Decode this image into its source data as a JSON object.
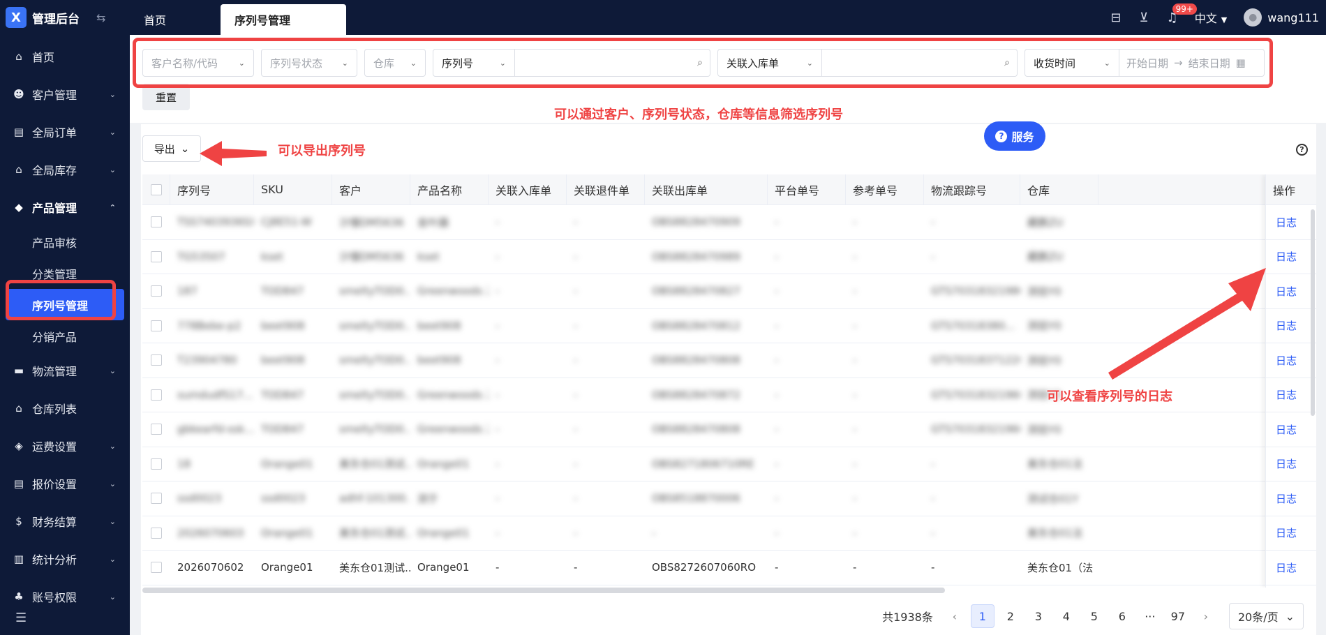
{
  "app": {
    "title": "管理后台",
    "logo_letter": "X"
  },
  "sidebar": {
    "items": [
      {
        "label": "首页",
        "icon": "home-icon",
        "glyph": "⌂",
        "arrow": ""
      },
      {
        "label": "客户管理",
        "icon": "users-icon",
        "glyph": "☻",
        "arrow": "⌄"
      },
      {
        "label": "全局订单",
        "icon": "clipboard-icon",
        "glyph": "▤",
        "arrow": "⌄"
      },
      {
        "label": "全局库存",
        "icon": "warehouse-icon",
        "glyph": "⌂",
        "arrow": "⌄"
      },
      {
        "label": "产品管理",
        "icon": "box-icon",
        "glyph": "◆",
        "arrow": "⌃"
      }
    ],
    "sub_items": [
      {
        "label": "产品审核"
      },
      {
        "label": "分类管理"
      },
      {
        "label": "序列号管理"
      },
      {
        "label": "分销产品"
      }
    ],
    "items_after": [
      {
        "label": "物流管理",
        "icon": "truck-icon",
        "glyph": "▬",
        "arrow": "⌄"
      },
      {
        "label": "仓库列表",
        "icon": "warehouse-list-icon",
        "glyph": "⌂",
        "arrow": ""
      },
      {
        "label": "运费设置",
        "icon": "shipping-fee-icon",
        "glyph": "◈",
        "arrow": "⌄"
      },
      {
        "label": "报价设置",
        "icon": "quote-icon",
        "glyph": "▤",
        "arrow": "⌄"
      },
      {
        "label": "财务结算",
        "icon": "finance-icon",
        "glyph": "$",
        "arrow": "⌄"
      },
      {
        "label": "统计分析",
        "icon": "chart-icon",
        "glyph": "▥",
        "arrow": "⌄"
      },
      {
        "label": "账号权限",
        "icon": "org-icon",
        "glyph": "♣",
        "arrow": "⌄"
      }
    ]
  },
  "topbar": {
    "tabs": [
      {
        "label": "首页"
      },
      {
        "label": "序列号管理"
      }
    ],
    "notification_badge": "99+",
    "language": "中文",
    "username": "wang111"
  },
  "filters": {
    "customer_placeholder": "客户名称/代码",
    "status_placeholder": "序列号状态",
    "warehouse_placeholder": "仓库",
    "serial_type": "序列号",
    "inbound_type": "关联入库单",
    "time_type": "收货时间",
    "start_date": "开始日期",
    "end_date": "结束日期",
    "reset_label": "重置"
  },
  "annotations": {
    "filter_note": "可以通过客户、序列号状态，仓库等信息筛选序列号",
    "export_note": "可以导出序列号",
    "log_note": "可以查看序列号的日志"
  },
  "toolbar": {
    "export_label": "导出",
    "service_label": "服务"
  },
  "table": {
    "columns": [
      "序列号",
      "SKU",
      "客户",
      "产品名称",
      "关联入库单",
      "关联退件单",
      "关联出库单",
      "平台单号",
      "参考单号",
      "物流跟踪号",
      "仓库"
    ],
    "op_header": "操作",
    "op_label": "日志",
    "rows": [
      [
        "TSS7403936SX",
        "CJ8E51-W",
        "沙慢DM5636",
        "金叶器",
        "-",
        "-",
        "OBS8828470909",
        "-",
        "-",
        "-",
        "藏鹏ZU"
      ],
      [
        "TG53507",
        "kset",
        "沙慢DM5636",
        "kset",
        "-",
        "-",
        "OBS8828470989",
        "-",
        "-",
        "-",
        "藏鹏ZU"
      ],
      [
        "187",
        "TOD847",
        "smeltyTOD0...",
        "Greenwoods 26...",
        "-",
        "-",
        "OBS8828470827",
        "-",
        "-",
        "GTS70318321980...",
        "测验Y0"
      ],
      [
        "778Bebe-p2",
        "beet908",
        "smeltyTOD0...",
        "beet908",
        "-",
        "-",
        "OBS8828470812",
        "-",
        "-",
        "GTS70318380...",
        "测验Y0"
      ],
      [
        "T23904780",
        "beet908",
        "smeltyTOD0...",
        "beet908",
        "-",
        "-",
        "OBS8828470808",
        "-",
        "-",
        "GTS70318371220...",
        "测验Y0"
      ],
      [
        "sumdudfS17...",
        "TOD847",
        "smeltyTOD0...",
        "Greenwoods 26...",
        "-",
        "-",
        "OBS8828470872",
        "-",
        "-",
        "GTS70318321960...",
        "测验Y0"
      ],
      [
        "gbkearfd-ssk...",
        "TOD847",
        "smeltyTOD0...",
        "Greenwoods 26...",
        "-",
        "-",
        "OBS8828470808",
        "-",
        "-",
        "GTS70318321960...",
        "测验Y0"
      ],
      [
        "18",
        "Orange01",
        "美东仓01测试...",
        "Orange01",
        "-",
        "-",
        "OBS8271806710RE",
        "-",
        "-",
        "-",
        "美东仓01法"
      ],
      [
        "ssd0023",
        "ssd0023",
        "adhf-101300...",
        "测于",
        "-",
        "-",
        "OBS8518870006",
        "-",
        "-",
        "-",
        "测试仓01Y"
      ],
      [
        "2026070603",
        "Orange01",
        "美东仓01测试...",
        "Orange01",
        "-",
        "-",
        "-",
        "-",
        "-",
        "-",
        "美东仓01法"
      ],
      [
        "2026070602",
        "Orange01",
        "美东仓01测试...",
        "Orange01",
        "-",
        "-",
        "OBS8272607060RO",
        "-",
        "-",
        "-",
        "美东仓01（法"
      ]
    ],
    "row_blurred": [
      true,
      true,
      true,
      true,
      true,
      true,
      true,
      true,
      true,
      true,
      false
    ]
  },
  "pagination": {
    "total": "共1938条",
    "pages": [
      "1",
      "2",
      "3",
      "4",
      "5",
      "6",
      "···",
      "97"
    ],
    "current": "1",
    "page_size": "20条/页"
  },
  "colors": {
    "sidebar_bg": "#0e1a38",
    "accent": "#2d5cf6",
    "annotation_red": "#ef4343"
  }
}
